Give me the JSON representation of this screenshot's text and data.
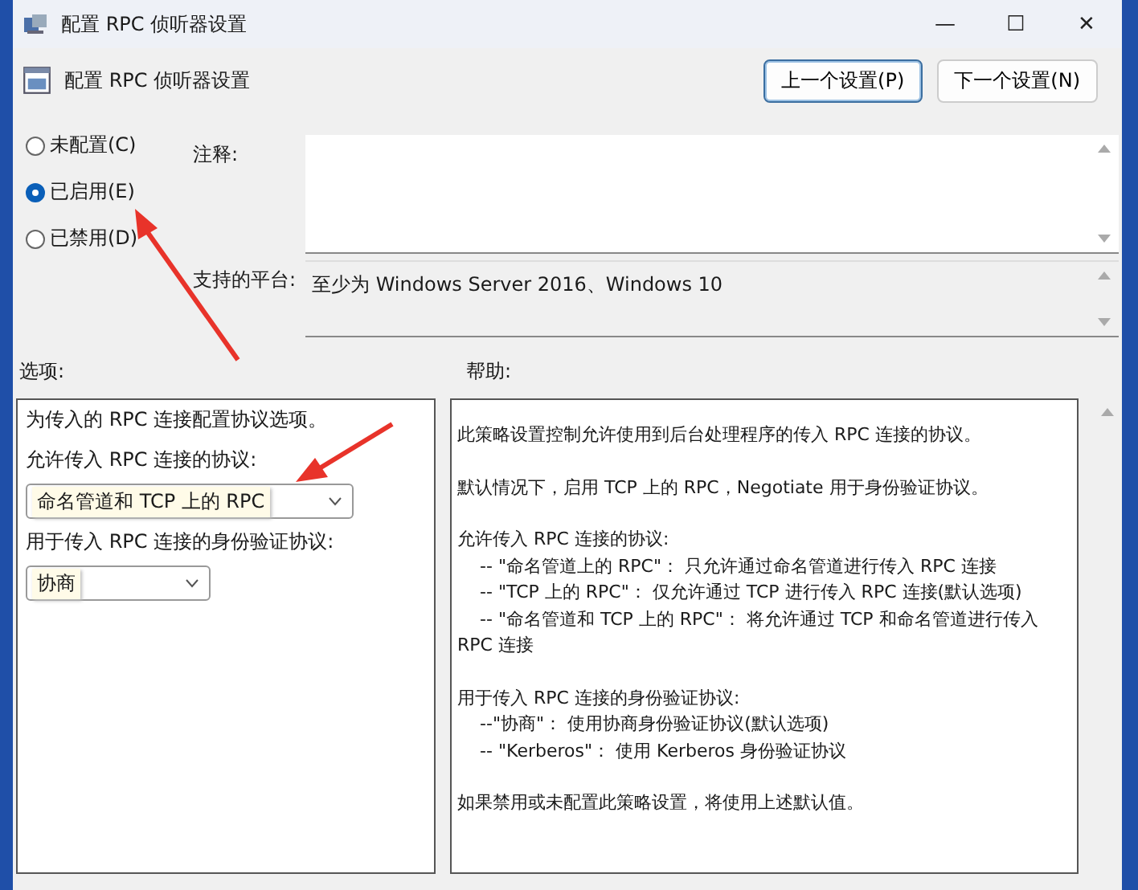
{
  "window": {
    "title": "配置 RPC 侦听器设置",
    "controls": [
      "—",
      "☐",
      "✕"
    ]
  },
  "header": {
    "title": "配置 RPC 侦听器设置"
  },
  "nav_buttons": [
    {
      "label": "上一个设置(P)",
      "selected": true
    },
    {
      "label": "下一个设置(N)",
      "selected": false
    }
  ],
  "state_options": [
    {
      "label": "未配置(C)",
      "selected": false
    },
    {
      "label": "已启用(E)",
      "selected": true
    },
    {
      "label": "已禁用(D)",
      "selected": false
    }
  ],
  "comment": {
    "label": "注释:"
  },
  "platform": {
    "label": "支持的平台:",
    "value": "至少为 Windows Server 2016、Windows 10"
  },
  "options": {
    "label": "选项:",
    "items": [
      {
        "kind": "text",
        "text": "为传入的 RPC 连接配置协议选项。"
      },
      {
        "kind": "text",
        "text": "允许传入 RPC 连接的协议:"
      },
      {
        "kind": "dropdown",
        "value": "命名管道和 TCP 上的 RPC",
        "wide": true
      },
      {
        "kind": "text",
        "text": "用于传入 RPC 连接的身份验证协议:"
      },
      {
        "kind": "dropdown",
        "value": "协商",
        "wide": false
      }
    ]
  },
  "help": {
    "label": "帮助:",
    "paragraphs": [
      [
        "此策略设置控制允许使用到后台处理程序的传入 RPC 连接的协议。"
      ],
      [
        "默认情况下，启用 TCP 上的 RPC，Negotiate 用于身份验证协议。"
      ],
      [
        "允许传入 RPC 连接的协议:",
        "    -- \"命名管道上的 RPC\"： 只允许通过命名管道进行传入 RPC 连接",
        "    -- \"TCP 上的 RPC\"： 仅允许通过 TCP 进行传入 RPC 连接(默认选项)",
        "    -- \"命名管道和 TCP 上的 RPC\"： 将允许通过 TCP 和命名管道进行传入 RPC 连接"
      ],
      [
        "用于传入 RPC 连接的身份验证协议:",
        "    --\"协商\"： 使用协商身份验证协议(默认选项)",
        "    -- \"Kerberos\"： 使用 Kerberos 身份验证协议"
      ],
      [
        "如果禁用或未配置此策略设置，将使用上述默认值。"
      ]
    ]
  }
}
